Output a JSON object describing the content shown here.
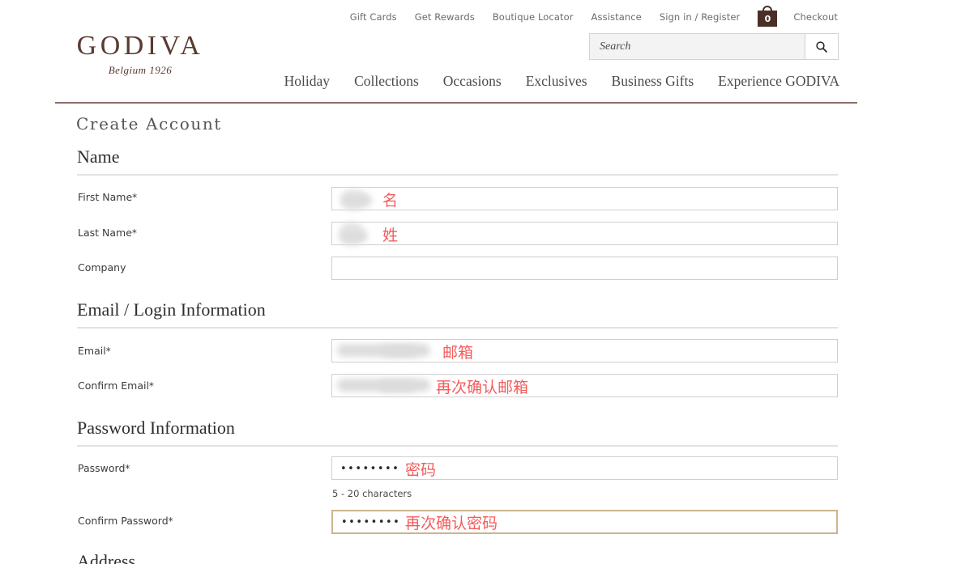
{
  "utility_nav": {
    "items": [
      {
        "label": "Gift Cards",
        "name": "gift-cards"
      },
      {
        "label": "Get Rewards",
        "name": "get-rewards"
      },
      {
        "label": "Boutique Locator",
        "name": "boutique-locator"
      },
      {
        "label": "Assistance",
        "name": "assistance"
      },
      {
        "label": "Sign in / Register",
        "name": "sign-in-register"
      }
    ],
    "cart_count": "0",
    "checkout_label": "Checkout"
  },
  "brand": {
    "wordmark": "GODIVA",
    "tagline": "Belgium 1926",
    "color": "#5a3a31"
  },
  "search": {
    "placeholder": "Search",
    "value": "",
    "icon": "search-icon"
  },
  "main_nav": {
    "items": [
      {
        "label": "Holiday"
      },
      {
        "label": "Collections"
      },
      {
        "label": "Occasions"
      },
      {
        "label": "Exclusives"
      },
      {
        "label": "Business Gifts"
      },
      {
        "label": "Experience GODIVA"
      }
    ]
  },
  "page": {
    "title": "Create Account",
    "accent_rule_color": "#8d6e6a",
    "annotation_color": "#f45c5c",
    "focus_border_color": "#c9b68c"
  },
  "sections": {
    "name": {
      "heading": "Name",
      "fields": [
        {
          "label": "First Name",
          "required": "*",
          "value_redacted": true,
          "annotation": "名"
        },
        {
          "label": "Last Name",
          "required": "*",
          "value_redacted": true,
          "annotation": "姓"
        },
        {
          "label": "Company",
          "required": "",
          "value_redacted": false,
          "annotation": ""
        }
      ]
    },
    "email": {
      "heading": "Email / Login Information",
      "fields": [
        {
          "label": "Email",
          "required": "*",
          "value_redacted": true,
          "annotation": "邮箱"
        },
        {
          "label": "Confirm Email",
          "required": "*",
          "value_redacted": true,
          "annotation": "再次确认邮箱"
        }
      ]
    },
    "password": {
      "heading": "Password Information",
      "hint": "5 - 20 characters",
      "fields": [
        {
          "label": "Password",
          "required": "*",
          "masked_value": "••••••••",
          "annotation": "密码",
          "focused": false
        },
        {
          "label": "Confirm Password",
          "required": "*",
          "masked_value": "••••••••",
          "annotation": "再次确认密码",
          "focused": true
        }
      ]
    },
    "address": {
      "heading": "Address"
    }
  }
}
